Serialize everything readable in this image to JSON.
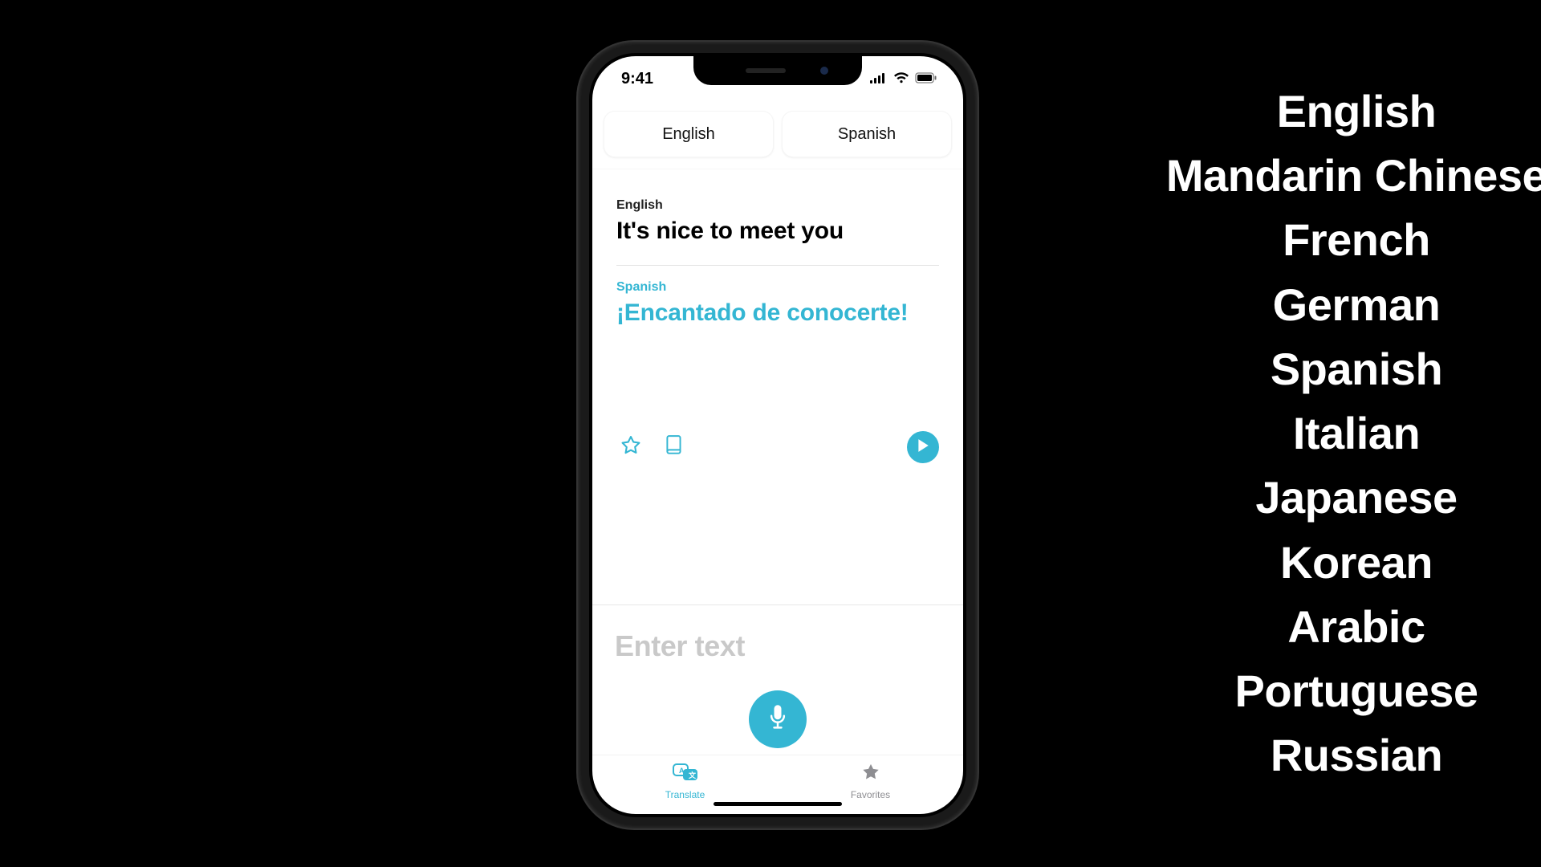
{
  "status": {
    "time": "9:41"
  },
  "languages": {
    "source_chip": "English",
    "target_chip": "Spanish"
  },
  "translation": {
    "source_label": "English",
    "source_text": "It's nice to meet you",
    "target_label": "Spanish",
    "target_text": "¡Encantado de conocerte!"
  },
  "input": {
    "placeholder": "Enter text"
  },
  "tabs": {
    "translate": "Translate",
    "favorites": "Favorites"
  },
  "side_languages": [
    "English",
    "Mandarin Chinese",
    "French",
    "German",
    "Spanish",
    "Italian",
    "Japanese",
    "Korean",
    "Arabic",
    "Portuguese",
    "Russian"
  ],
  "colors": {
    "accent": "#34b6d3"
  }
}
